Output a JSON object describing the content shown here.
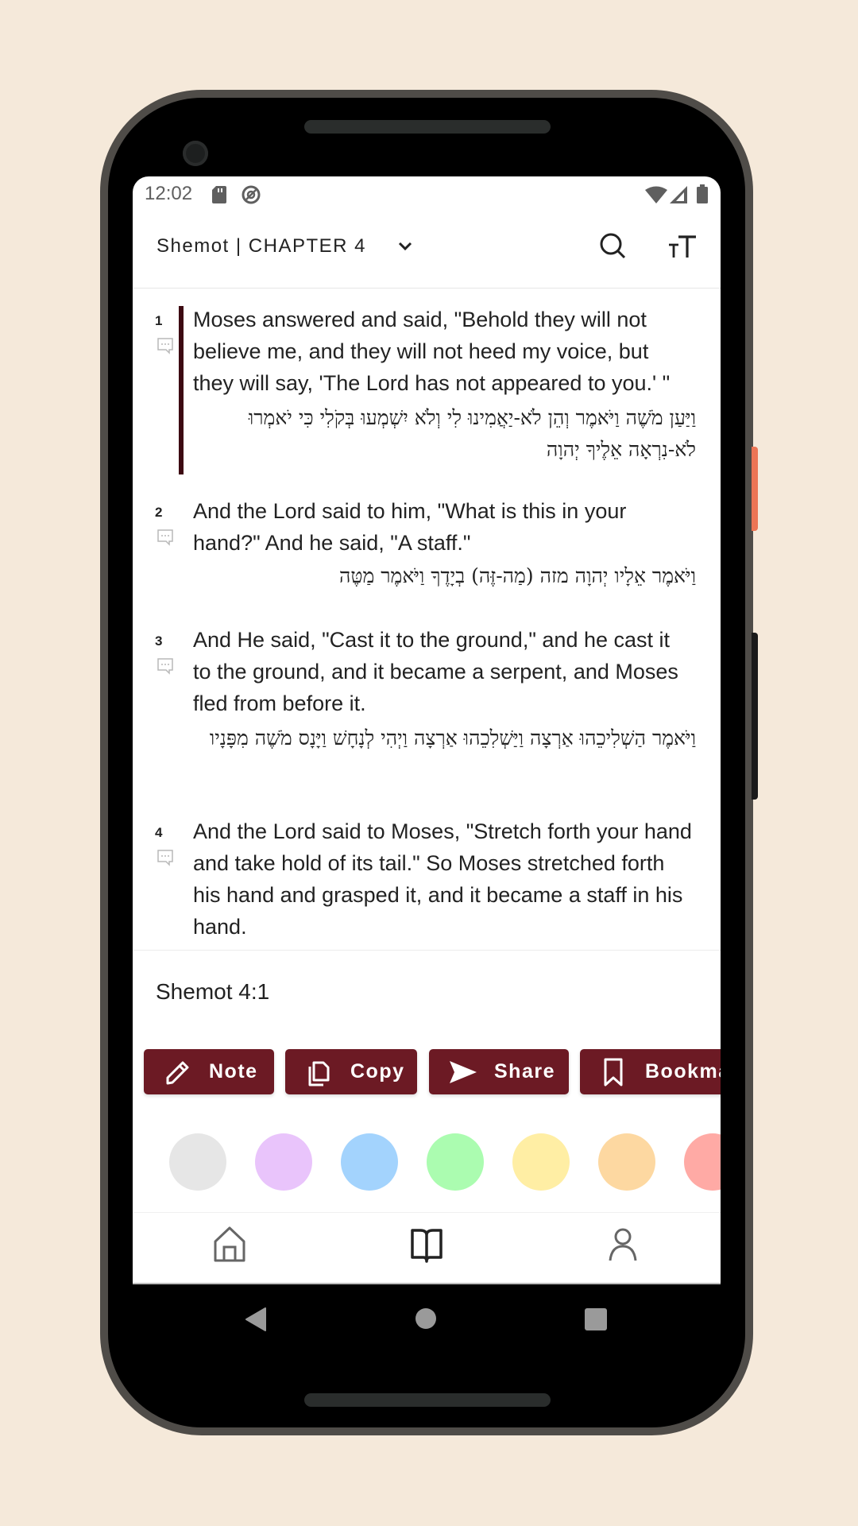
{
  "status_bar": {
    "time": "12:02",
    "left_icons": [
      "sd-card-icon",
      "do-not-disturb-icon"
    ],
    "right_icons": [
      "wifi-icon",
      "signal-icon",
      "battery-icon"
    ]
  },
  "app_bar": {
    "title": "Shemot | CHAPTER 4",
    "dropdown_icon": "chevron-down-icon",
    "actions": [
      "search-icon",
      "text-size-icon"
    ]
  },
  "verses": [
    {
      "number": "1",
      "selected": true,
      "english": "Moses answered and said, \"Behold they will not believe me, and they will not heed my voice, but they will say, 'The Lord has not appeared to you.' \"",
      "hebrew": "וַיַּעַן מֹשֶׁה וַיֹּאמֶר וְהֵן לֹא-יַאֲמִינוּ לִי וְלֹא יִשְׁמְעוּ בְּקֹלִי כִּי יֹאמְרוּ לֹא-נִרְאָה אֵלֶיךָ יְהוָה"
    },
    {
      "number": "2",
      "selected": false,
      "english": "And the Lord said to him, \"What is this in your hand?\" And he said, \"A staff.\"",
      "hebrew": "וַיֹּאמֶר אֵלָיו יְהוָה מזה (מַה-זֶּה) בְיָדֶךָ וַיֹּאמֶר מַטֶּה"
    },
    {
      "number": "3",
      "selected": false,
      "english": "And He said, \"Cast it to the ground,\" and he cast it to the ground, and it became a serpent, and Moses fled from before it.",
      "hebrew": "וַיֹּאמֶר הַשְׁלִיכֵהוּ אַרְצָה וַיַּשְׁלִכֵהוּ אַרְצָה וַיְהִי לְנָחָשׁ וַיָּנָס מֹשֶׁה מִפָּנָיו"
    },
    {
      "number": "4",
      "selected": false,
      "english": "And the Lord said to Moses, \"Stretch forth your hand and take hold of its tail.\" So Moses stretched forth his hand and grasped it, and it became a staff in his hand.",
      "hebrew": ""
    }
  ],
  "selection_panel": {
    "reference": "Shemot 4:1",
    "actions": [
      {
        "label": "Note",
        "icon": "pencil-icon"
      },
      {
        "label": "Copy",
        "icon": "copy-icon"
      },
      {
        "label": "Share",
        "icon": "send-icon"
      },
      {
        "label": "Bookmark",
        "icon": "bookmark-icon"
      }
    ],
    "highlight_colors": [
      "#e6e6e6",
      "#e9c4fb",
      "#a3d3fd",
      "#abfcb0",
      "#ffeea4",
      "#fdd8a1",
      "#ffaaa5"
    ]
  },
  "bottom_nav": {
    "items": [
      {
        "name": "home",
        "icon": "home-icon",
        "active": false
      },
      {
        "name": "read",
        "icon": "book-icon",
        "active": true
      },
      {
        "name": "profile",
        "icon": "person-icon",
        "active": false
      }
    ]
  },
  "colors": {
    "accent": "#6c1a24",
    "selection_bar": "#3d0a12",
    "background": "#f5e9da"
  }
}
